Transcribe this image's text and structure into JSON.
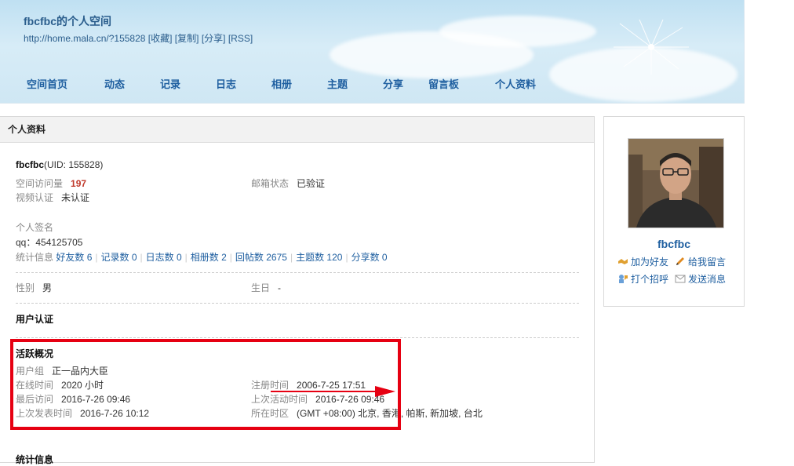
{
  "header": {
    "title": "fbcfbc的个人空间",
    "url": "http://home.mala.cn/?155828",
    "links": [
      "[收藏]",
      "[复制]",
      "[分享]",
      "[RSS]"
    ]
  },
  "nav": [
    "空间首页",
    "动态",
    "记录",
    "日志",
    "相册",
    "主题",
    "分享",
    "留言板",
    "个人资料"
  ],
  "main": {
    "panel_title": "个人资料",
    "username": "fbcfbc",
    "uid": "(UID: 155828)",
    "visits_label": "空间访问量",
    "visits_value": "197",
    "email_label": "邮箱状态",
    "email_value": "已验证",
    "video_label": "视频认证",
    "video_value": "未认证",
    "sign_label": "个人签名",
    "sign_value": "qq：454125705",
    "stats_label": "统计信息",
    "stats": [
      "好友数 6",
      "记录数 0",
      "日志数 0",
      "相册数 2",
      "回帖数 2675",
      "主题数 120",
      "分享数 0"
    ],
    "gender_label": "性别",
    "gender_value": "男",
    "birthday_label": "生日",
    "birthday_value": "-",
    "auth_title": "用户认证",
    "activity_title": "活跃概况",
    "group_label": "用户组",
    "group_value": "正一品内大臣",
    "online_label": "在线时间",
    "online_value": "2020 小时",
    "reg_label": "注册时间",
    "reg_value": "2006-7-25 17:51",
    "lastvisit_label": "最后访问",
    "lastvisit_value": "2016-7-26 09:46",
    "lastactive_label": "上次活动时间",
    "lastactive_value": "2016-7-26 09:46",
    "lastpost_label": "上次发表时间",
    "lastpost_value": "2016-7-26 10:12",
    "tz_label": "所在时区",
    "tz_value": "(GMT +08:00) 北京, 香港, 帕斯, 新加坡, 台北",
    "partial_title": "统计信息"
  },
  "sidebar": {
    "username": "fbcfbc",
    "add_friend": "加为好友",
    "leave_msg": "给我留言",
    "greet": "打个招呼",
    "send_msg": "发送消息"
  },
  "colors": {
    "link": "#1f5fa0",
    "highlight": "#e60012",
    "visits": "#c0392b"
  }
}
